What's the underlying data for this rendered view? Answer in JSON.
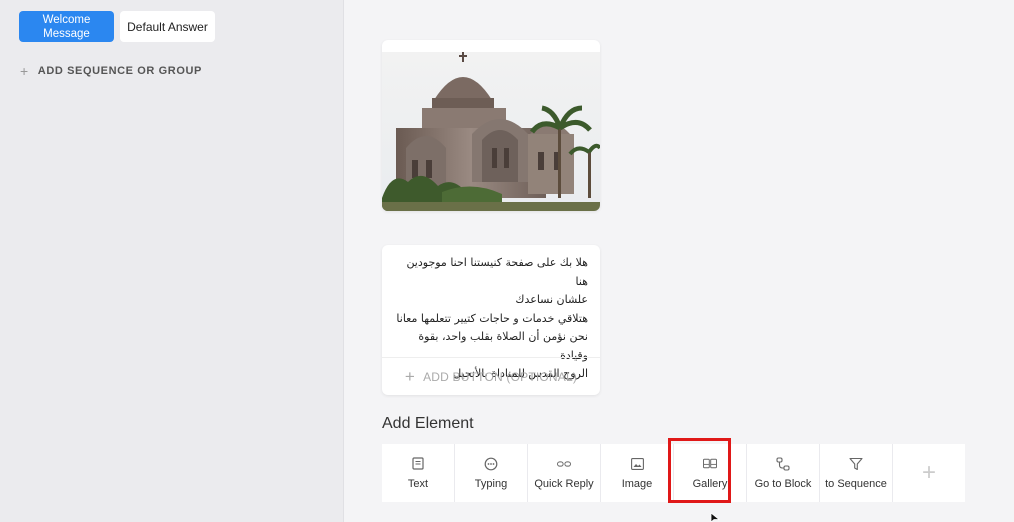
{
  "sidebar": {
    "blocks": [
      {
        "label": "Welcome Message",
        "active": true
      },
      {
        "label": "Default Answer",
        "active": false
      }
    ],
    "add_sequence_label": "ADD SEQUENCE OR GROUP"
  },
  "message": {
    "lines": "هلا بك على صفحة كنيستنا احنا موجودين هنا\nعلشان نساعدك\nهتلاقي خدمات و حاجات كتيير تتعلمها معانا\nنحن نؤمن أن الصلاة بقلب واحد، بقوة وقيادة\nالروح القدس للمناداة بالأنجيل",
    "add_button_label": "ADD BUTTON (OPTIONAL)"
  },
  "add_element": {
    "title": "Add Element",
    "tools": [
      {
        "label": "Text",
        "icon": "text-icon"
      },
      {
        "label": "Typing",
        "icon": "typing-icon"
      },
      {
        "label": "Quick Reply",
        "icon": "quick-reply-icon"
      },
      {
        "label": "Image",
        "icon": "image-icon"
      },
      {
        "label": "Gallery",
        "icon": "gallery-icon",
        "highlighted": true
      },
      {
        "label": "Go to Block",
        "icon": "go-to-block-icon"
      },
      {
        "label": "to Sequence",
        "icon": "filter-icon"
      }
    ]
  },
  "colors": {
    "accent": "#2b87f0",
    "highlight": "#e01818"
  }
}
